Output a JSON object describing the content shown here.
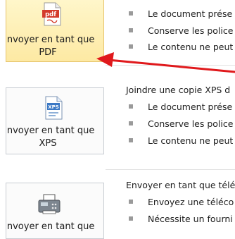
{
  "options": [
    {
      "id": "pdf",
      "label": "Envoyer en tant que\nPDF",
      "icon": "pdf-file-icon",
      "selected": true,
      "title": "",
      "bullets": [
        "Le document prése",
        "Conserve les police",
        "Le contenu ne peut"
      ]
    },
    {
      "id": "xps",
      "label": "Envoyer en tant que\nXPS",
      "icon": "xps-file-icon",
      "selected": false,
      "title": "Joindre une copie XPS d",
      "bullets": [
        "Le document prése",
        "Conserve les police",
        "Le contenu ne peut"
      ]
    },
    {
      "id": "fax",
      "label": "Envoyer en tant que",
      "icon": "fax-icon",
      "selected": false,
      "title": "Envoyer en tant que télé",
      "bullets": [
        "Envoyez une téléco",
        "Nécessite un fourni"
      ]
    }
  ],
  "colors": {
    "selected_fill": "#fde9a3",
    "arrow": "#e0191c",
    "pdf_icon": "#d33b2c",
    "xps_icon": "#3b78c4"
  }
}
